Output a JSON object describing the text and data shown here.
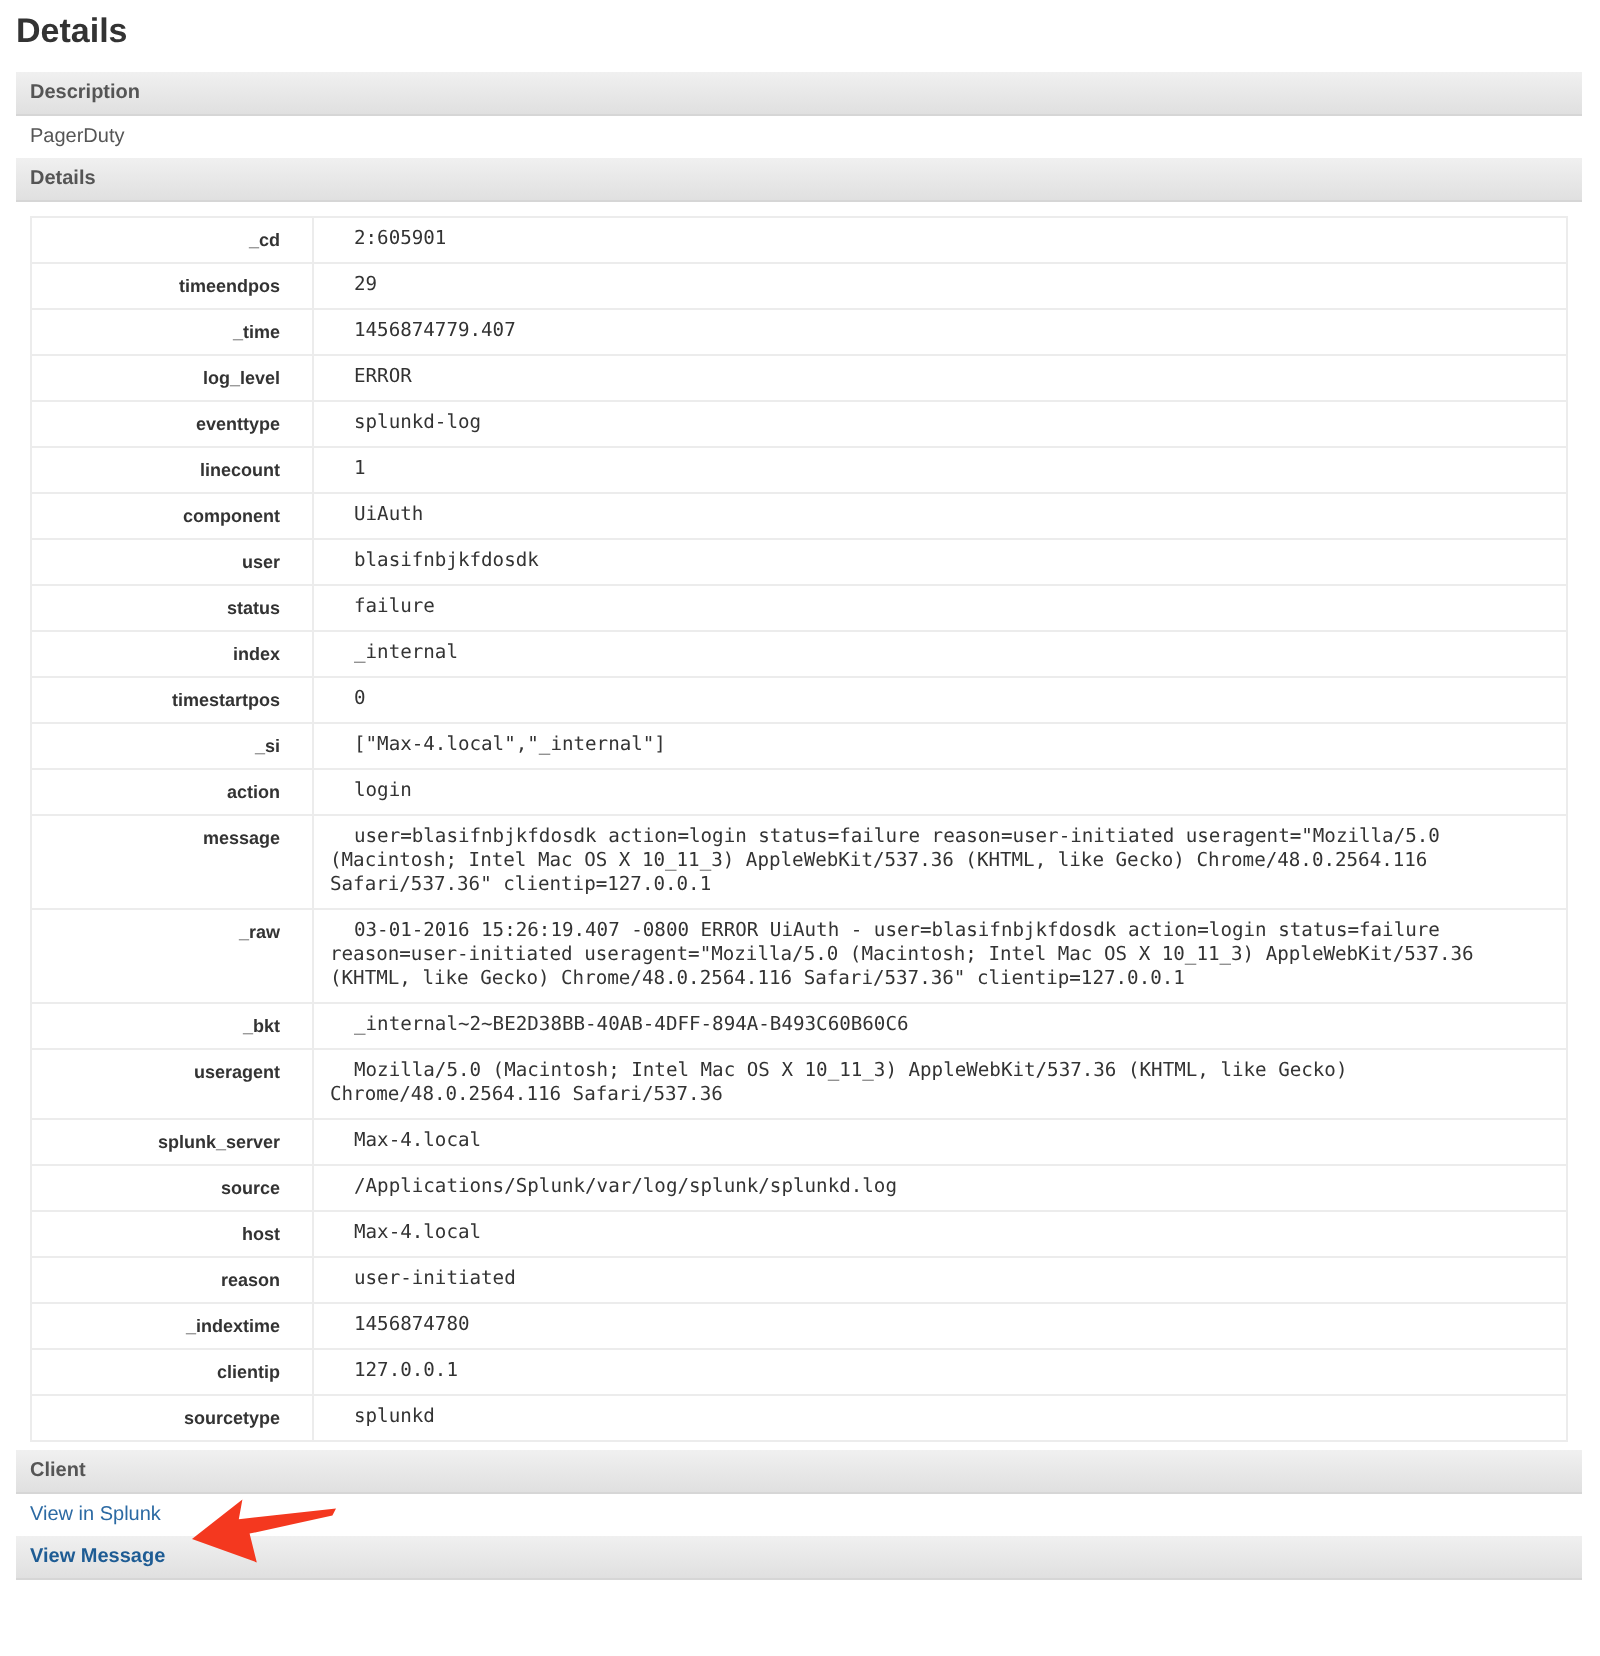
{
  "title": "Details",
  "sections": [
    {
      "heading": "Description",
      "kind": "text",
      "text": "PagerDuty"
    },
    {
      "heading": "Details",
      "kind": "table",
      "rows": [
        {
          "key": "_cd",
          "value": "2:605901"
        },
        {
          "key": "timeendpos",
          "value": "29"
        },
        {
          "key": "_time",
          "value": "1456874779.407"
        },
        {
          "key": "log_level",
          "value": "ERROR"
        },
        {
          "key": "eventtype",
          "value": "splunkd-log"
        },
        {
          "key": "linecount",
          "value": "1"
        },
        {
          "key": "component",
          "value": "UiAuth"
        },
        {
          "key": "user",
          "value": "blasifnbjkfdosdk"
        },
        {
          "key": "status",
          "value": "failure"
        },
        {
          "key": "index",
          "value": "_internal"
        },
        {
          "key": "timestartpos",
          "value": "0"
        },
        {
          "key": "_si",
          "value": "[\"Max-4.local\",\"_internal\"]"
        },
        {
          "key": "action",
          "value": "login"
        },
        {
          "key": "message",
          "value": "user=blasifnbjkfdosdk action=login status=failure reason=user-initiated useragent=\"Mozilla/5.0 (Macintosh; Intel Mac OS X 10_11_3) AppleWebKit/537.36 (KHTML, like Gecko) Chrome/48.0.2564.116 Safari/537.36\" clientip=127.0.0.1"
        },
        {
          "key": "_raw",
          "value": "03-01-2016 15:26:19.407 -0800 ERROR UiAuth - user=blasifnbjkfdosdk action=login status=failure reason=user-initiated useragent=\"Mozilla/5.0 (Macintosh; Intel Mac OS X 10_11_3) AppleWebKit/537.36 (KHTML, like Gecko) Chrome/48.0.2564.116 Safari/537.36\" clientip=127.0.0.1"
        },
        {
          "key": "_bkt",
          "value": "_internal~2~BE2D38BB-40AB-4DFF-894A-B493C60B60C6"
        },
        {
          "key": "useragent",
          "value": "Mozilla/5.0 (Macintosh; Intel Mac OS X 10_11_3) AppleWebKit/537.36 (KHTML, like Gecko) Chrome/48.0.2564.116 Safari/537.36"
        },
        {
          "key": "splunk_server",
          "value": "Max-4.local"
        },
        {
          "key": "source",
          "value": "/Applications/Splunk/var/log/splunk/splunkd.log"
        },
        {
          "key": "host",
          "value": "Max-4.local"
        },
        {
          "key": "reason",
          "value": "user-initiated"
        },
        {
          "key": "_indextime",
          "value": "1456874780"
        },
        {
          "key": "clientip",
          "value": "127.0.0.1"
        },
        {
          "key": "sourcetype",
          "value": "splunkd"
        }
      ]
    },
    {
      "heading": "Client",
      "kind": "link",
      "text": "View in Splunk"
    },
    {
      "heading": "View Message",
      "kind": "heading_link"
    }
  ]
}
